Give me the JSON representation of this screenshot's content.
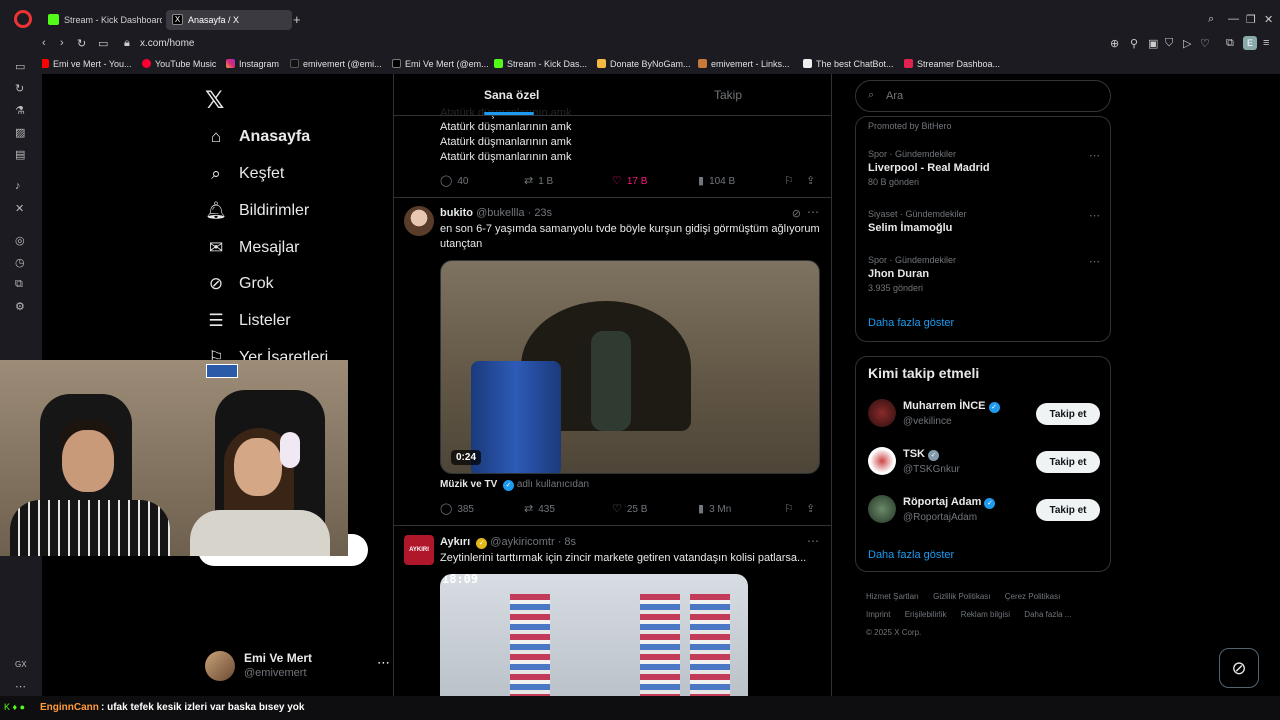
{
  "browser": {
    "tabs": [
      {
        "label": "Stream - Kick Dashboard",
        "active": false
      },
      {
        "label": "Anasayfa / X",
        "active": true
      }
    ],
    "url": "x.com/home",
    "profile_initial": "E",
    "bookmarks": [
      "Emi ve Mert - You...",
      "YouTube Music",
      "Instagram",
      "emivemert (@emi...",
      "Emi Ve Mert (@em...",
      "Stream - Kick Das...",
      "Donate ByNoGam...",
      "emivemert - Links...",
      "The best ChatBot...",
      "Streamer Dashboa..."
    ],
    "sidebar_label": "GX"
  },
  "nav": {
    "items": [
      {
        "label": "Anasayfa",
        "icon": "home-icon"
      },
      {
        "label": "Keşfet",
        "icon": "search-icon"
      },
      {
        "label": "Bildirimler",
        "icon": "bell-icon"
      },
      {
        "label": "Mesajlar",
        "icon": "mail-icon"
      },
      {
        "label": "Grok",
        "icon": "grok-icon"
      },
      {
        "label": "Listeler",
        "icon": "list-icon"
      },
      {
        "label": "Yer İşaretleri",
        "icon": "bookmark-icon"
      }
    ],
    "profile": {
      "name": "Emi Ve Mert",
      "handle": "@emivemert"
    }
  },
  "timeline": {
    "tabs": [
      {
        "label": "Sana özel",
        "active": true
      },
      {
        "label": "Takip",
        "active": false
      }
    ],
    "partial_post": {
      "lines": [
        "Atatürk düşmanlarının amk",
        "Atatürk düşmanlarının amk",
        "Atatürk düşmanlarının amk",
        "Atatürk düşmanlarının amk"
      ],
      "replies": "40",
      "reposts": "1 B",
      "likes": "17 B",
      "views": "104 B"
    },
    "post1": {
      "name": "bukito",
      "handle": "@bukellla",
      "time": "· 23s",
      "text": "en son 6-7 yaşımda samanyolu tvde böyle kurşun gidişi görmüştüm ağlıyorum utançtan",
      "video_duration": "0:24",
      "source_name": "Müzik ve TV",
      "source_by": "adlı kullanıcıdan",
      "replies": "385",
      "reposts": "435",
      "likes": "25 B",
      "views": "3 Mn"
    },
    "post2": {
      "name": "Aykırı",
      "handle": "@aykiricomtr",
      "time": "· 8s",
      "avatar_text": "AYKIRI",
      "text": "Zeytinlerini tarttırmak için zincir markete getiren vatandaşın kolisi patlarsa...",
      "image_timestamp": "18:09"
    }
  },
  "right": {
    "search_placeholder": "Ara",
    "promoted": "Promoted by BitHero",
    "trends": [
      {
        "category": "Spor · Gündemdekiler",
        "title": "Liverpool - Real Madrid",
        "count": "80 B gönderi"
      },
      {
        "category": "Siyaset · Gündemdekiler",
        "title": "Selim İmamoğlu",
        "count": ""
      },
      {
        "category": "Spor · Gündemdekiler",
        "title": "Jhon Duran",
        "count": "3.935 gönderi"
      }
    ],
    "show_more": "Daha fazla göster",
    "who_to_follow_title": "Kimi takip etmeli",
    "accounts": [
      {
        "name": "Muharrem İNCE",
        "handle": "@vekilince",
        "badge": "blue"
      },
      {
        "name": "TSK",
        "handle": "@TSKGnkur",
        "badge": "gray"
      },
      {
        "name": "Röportaj Adam",
        "handle": "@RoportajAdam",
        "badge": "blue"
      }
    ],
    "follow_label": "Takip et",
    "footer": [
      "Hizmet Şartları",
      "Gizlilik Politikası",
      "Çerez Politikası",
      "Imprint",
      "Erişilebilirlik",
      "Reklam bilgisi",
      "Daha fazla ...",
      "© 2025 X Corp."
    ]
  },
  "chat": {
    "user": "EnginnCann",
    "message": ": ufak tefek kesik izleri var baska bısey yok"
  },
  "colors": {
    "accent": "#1d9bf0",
    "like": "#f91880",
    "background": "#000000",
    "kick_green": "#53fc18"
  }
}
